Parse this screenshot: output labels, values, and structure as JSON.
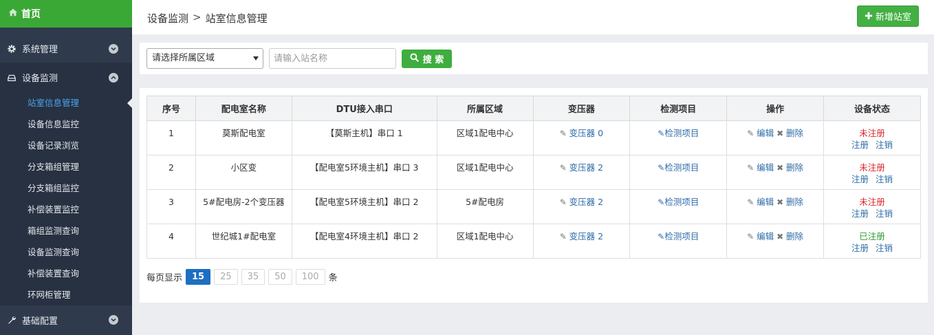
{
  "sidebar": {
    "home_label": "首页",
    "groups": [
      {
        "label": "系统管理",
        "icon": "gear-icon"
      },
      {
        "label": "设备监测",
        "icon": "hdd-icon"
      },
      {
        "label": "基础配置",
        "icon": "wrench-icon"
      }
    ],
    "subitems": [
      "站室信息管理",
      "设备信息监控",
      "设备记录浏览",
      "分支箱组管理",
      "分支箱组监控",
      "补偿装置监控",
      "箱组监测查询",
      "设备监测查询",
      "补偿装置查询",
      "环网柜管理"
    ]
  },
  "header": {
    "breadcrumb_parent": "设备监测",
    "breadcrumb_sep": ">",
    "breadcrumb_current": "站室信息管理",
    "add_button": "新增站室"
  },
  "search": {
    "region_selected": "请选择所属区域",
    "name_placeholder": "请输入站名称",
    "search_button": "搜 索"
  },
  "table": {
    "columns": [
      "序号",
      "配电室名称",
      "DTU接入串口",
      "所属区域",
      "变压器",
      "检测项目",
      "操作",
      "设备状态"
    ],
    "rows": [
      {
        "no": "1",
        "name": "莫斯配电室",
        "port": "【莫斯主机】串口 1",
        "region": "区域1配电中心",
        "transformer": "变压器 0",
        "check": "检测项目",
        "edit": "编辑",
        "delete": "删除",
        "status": "未注册",
        "register": "注册",
        "cancel": "注销"
      },
      {
        "no": "2",
        "name": "小区变",
        "port": "【配电室5环境主机】串口 3",
        "region": "区域1配电中心",
        "transformer": "变压器 2",
        "check": "检测项目",
        "edit": "编辑",
        "delete": "删除",
        "status": "未注册",
        "register": "注册",
        "cancel": "注销"
      },
      {
        "no": "3",
        "name": "5#配电房-2个变压器",
        "port": "【配电室5环境主机】串口 2",
        "region": "5#配电房",
        "transformer": "变压器 2",
        "check": "检测项目",
        "edit": "编辑",
        "delete": "删除",
        "status": "未注册",
        "register": "注册",
        "cancel": "注销"
      },
      {
        "no": "4",
        "name": "世纪城1#配电室",
        "port": "【配电室4环境主机】串口 2",
        "region": "区域1配电中心",
        "transformer": "变压器 2",
        "check": "检测项目",
        "edit": "编辑",
        "delete": "删除",
        "status": "已注册",
        "register": "注册",
        "cancel": "注销"
      }
    ]
  },
  "pager": {
    "prefix": "每页显示",
    "sizes": [
      "15",
      "25",
      "35",
      "50",
      "100"
    ],
    "selected": "15",
    "suffix": "条"
  },
  "colors": {
    "sidebar_bg": "#2f3a4c",
    "home_green": "#3aa835",
    "active_blue": "#4aa3ef",
    "link_blue": "#2d6ca8",
    "status_red": "#d9262a",
    "status_green": "#2d9a2d",
    "pager_blue": "#1d6fc2"
  }
}
